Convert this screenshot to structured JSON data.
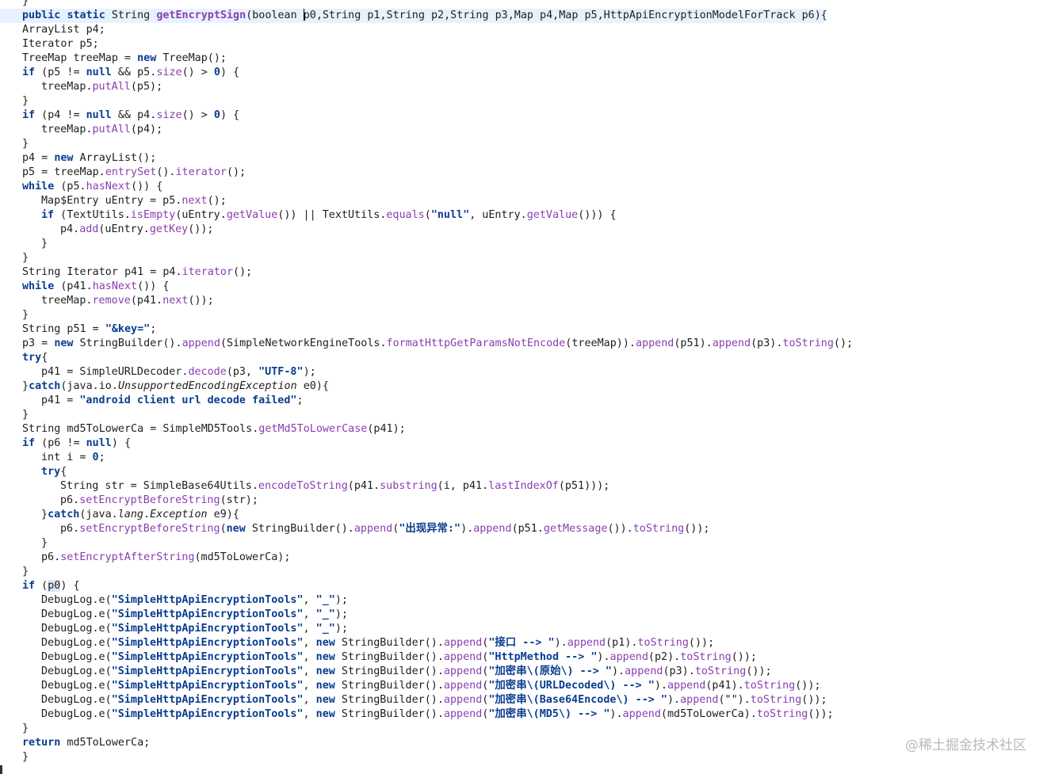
{
  "code_lines": [
    [
      {
        "t": "}"
      }
    ],
    [
      {
        "t": "public",
        "c": "kw"
      },
      {
        "t": " "
      },
      {
        "t": "static",
        "c": "kw"
      },
      {
        "t": " String "
      },
      {
        "t": "getEncryptSign",
        "c": "decl"
      },
      {
        "t": "(boolean "
      },
      {
        "t": "|",
        "c": "caret"
      },
      {
        "t": "p0,String p1,String p2,String p3,Map p4,Map p5,HttpApiEncryptionModelForTrack p6){"
      }
    ],
    [
      {
        "t": "ArrayList p4;"
      }
    ],
    [
      {
        "t": "Iterator p5;"
      }
    ],
    [
      {
        "t": "TreeMap treeMap = "
      },
      {
        "t": "new",
        "c": "kw"
      },
      {
        "t": " TreeMap();"
      }
    ],
    [
      {
        "t": "if",
        "c": "kw"
      },
      {
        "t": " (p5 != "
      },
      {
        "t": "null",
        "c": "kw"
      },
      {
        "t": " && p5."
      },
      {
        "t": "size",
        "c": "mth"
      },
      {
        "t": "() > "
      },
      {
        "t": "0",
        "c": "nm"
      },
      {
        "t": ") {"
      }
    ],
    [
      {
        "t": "treeMap."
      },
      {
        "t": "putAll",
        "c": "mth"
      },
      {
        "t": "(p5);"
      }
    ],
    [
      {
        "t": "}"
      }
    ],
    [
      {
        "t": "if",
        "c": "kw"
      },
      {
        "t": " (p4 != "
      },
      {
        "t": "null",
        "c": "kw"
      },
      {
        "t": " && p4."
      },
      {
        "t": "size",
        "c": "mth"
      },
      {
        "t": "() > "
      },
      {
        "t": "0",
        "c": "nm"
      },
      {
        "t": ") {"
      }
    ],
    [
      {
        "t": "treeMap."
      },
      {
        "t": "putAll",
        "c": "mth"
      },
      {
        "t": "(p4);"
      }
    ],
    [
      {
        "t": "}"
      }
    ],
    [
      {
        "t": "p4 = "
      },
      {
        "t": "new",
        "c": "kw"
      },
      {
        "t": " ArrayList();"
      }
    ],
    [
      {
        "t": "p5 = treeMap."
      },
      {
        "t": "entrySet",
        "c": "mth"
      },
      {
        "t": "()."
      },
      {
        "t": "iterator",
        "c": "mth"
      },
      {
        "t": "();"
      }
    ],
    [
      {
        "t": "while",
        "c": "kw"
      },
      {
        "t": " (p5."
      },
      {
        "t": "hasNext",
        "c": "mth"
      },
      {
        "t": "()) {"
      }
    ],
    [
      {
        "t": "Map$Entry uEntry = p5."
      },
      {
        "t": "next",
        "c": "mth"
      },
      {
        "t": "();"
      }
    ],
    [
      {
        "t": "if",
        "c": "kw"
      },
      {
        "t": " (TextUtils."
      },
      {
        "t": "isEmpty",
        "c": "mth"
      },
      {
        "t": "(uEntry."
      },
      {
        "t": "getValue",
        "c": "mth"
      },
      {
        "t": "()) || TextUtils."
      },
      {
        "t": "equals",
        "c": "mth"
      },
      {
        "t": "("
      },
      {
        "t": "\"null\"",
        "c": "str"
      },
      {
        "t": ", uEntry."
      },
      {
        "t": "getValue",
        "c": "mth"
      },
      {
        "t": "())) {"
      }
    ],
    [
      {
        "t": "p4."
      },
      {
        "t": "add",
        "c": "mth"
      },
      {
        "t": "(uEntry."
      },
      {
        "t": "getKey",
        "c": "mth"
      },
      {
        "t": "());"
      }
    ],
    [
      {
        "t": "}"
      }
    ],
    [
      {
        "t": "}"
      }
    ],
    [
      {
        "t": "String Iterator p41 = p4."
      },
      {
        "t": "iterator",
        "c": "mth"
      },
      {
        "t": "();"
      }
    ],
    [
      {
        "t": "while",
        "c": "kw"
      },
      {
        "t": " (p41."
      },
      {
        "t": "hasNext",
        "c": "mth"
      },
      {
        "t": "()) {"
      }
    ],
    [
      {
        "t": "treeMap."
      },
      {
        "t": "remove",
        "c": "mth"
      },
      {
        "t": "(p41."
      },
      {
        "t": "next",
        "c": "mth"
      },
      {
        "t": "());"
      }
    ],
    [
      {
        "t": "}"
      }
    ],
    [
      {
        "t": "String p51 = "
      },
      {
        "t": "\"&key=\"",
        "c": "str"
      },
      {
        "t": ";"
      }
    ],
    [
      {
        "t": "p3 = "
      },
      {
        "t": "new",
        "c": "kw"
      },
      {
        "t": " StringBuilder()."
      },
      {
        "t": "append",
        "c": "mth"
      },
      {
        "t": "(SimpleNetworkEngineTools."
      },
      {
        "t": "formatHttpGetParamsNotEncode",
        "c": "mth"
      },
      {
        "t": "(treeMap))."
      },
      {
        "t": "append",
        "c": "mth"
      },
      {
        "t": "(p51)."
      },
      {
        "t": "append",
        "c": "mth"
      },
      {
        "t": "(p3)."
      },
      {
        "t": "toString",
        "c": "mth"
      },
      {
        "t": "();"
      }
    ],
    [
      {
        "t": "try",
        "c": "kw"
      },
      {
        "t": "{"
      }
    ],
    [
      {
        "t": "p41 = SimpleURLDecoder."
      },
      {
        "t": "decode",
        "c": "mth"
      },
      {
        "t": "(p3, "
      },
      {
        "t": "\"UTF-8\"",
        "c": "str"
      },
      {
        "t": ");"
      }
    ],
    [
      {
        "t": "}"
      },
      {
        "t": "catch",
        "c": "kw"
      },
      {
        "t": "(java.io."
      },
      {
        "t": "UnsupportedEncodingException",
        "c": "it"
      },
      {
        "t": " e0){"
      }
    ],
    [
      {
        "t": "p41 = "
      },
      {
        "t": "\"android client url decode failed\"",
        "c": "str"
      },
      {
        "t": ";"
      }
    ],
    [
      {
        "t": "}"
      }
    ],
    [
      {
        "t": "String md5ToLowerCa = SimpleMD5Tools."
      },
      {
        "t": "getMd5ToLowerCase",
        "c": "mth"
      },
      {
        "t": "(p41);"
      }
    ],
    [
      {
        "t": "if",
        "c": "kw"
      },
      {
        "t": " (p6 != "
      },
      {
        "t": "null",
        "c": "kw"
      },
      {
        "t": ") {"
      }
    ],
    [
      {
        "t": "int i = "
      },
      {
        "t": "0",
        "c": "nm"
      },
      {
        "t": ";"
      }
    ],
    [
      {
        "t": "try",
        "c": "kw"
      },
      {
        "t": "{"
      }
    ],
    [
      {
        "t": "String str = SimpleBase64Utils."
      },
      {
        "t": "encodeToString",
        "c": "mth"
      },
      {
        "t": "(p41."
      },
      {
        "t": "substring",
        "c": "mth"
      },
      {
        "t": "(i, p41."
      },
      {
        "t": "lastIndexOf",
        "c": "mth"
      },
      {
        "t": "(p51)));"
      }
    ],
    [
      {
        "t": "p6."
      },
      {
        "t": "setEncryptBeforeString",
        "c": "mth"
      },
      {
        "t": "(str);"
      }
    ],
    [
      {
        "t": "}"
      },
      {
        "t": "catch",
        "c": "kw"
      },
      {
        "t": "(java."
      },
      {
        "t": "lang",
        "c": "it"
      },
      {
        "t": "."
      },
      {
        "t": "Exception",
        "c": "it"
      },
      {
        "t": " e9){"
      }
    ],
    [
      {
        "t": "p6."
      },
      {
        "t": "setEncryptBeforeString",
        "c": "mth"
      },
      {
        "t": "("
      },
      {
        "t": "new",
        "c": "kw"
      },
      {
        "t": " StringBuilder()."
      },
      {
        "t": "append",
        "c": "mth"
      },
      {
        "t": "("
      },
      {
        "t": "\"出现异常:\"",
        "c": "str"
      },
      {
        "t": ")."
      },
      {
        "t": "append",
        "c": "mth"
      },
      {
        "t": "(p51."
      },
      {
        "t": "getMessage",
        "c": "mth"
      },
      {
        "t": "())."
      },
      {
        "t": "toString",
        "c": "mth"
      },
      {
        "t": "());"
      }
    ],
    [
      {
        "t": "}"
      }
    ],
    [
      {
        "t": "p6."
      },
      {
        "t": "setEncryptAfterString",
        "c": "mth"
      },
      {
        "t": "(md5ToLowerCa);"
      }
    ],
    [
      {
        "t": "}"
      }
    ],
    [
      {
        "t": "if",
        "c": "kw"
      },
      {
        "t": " ("
      },
      {
        "t": "p0",
        "c": "hl"
      },
      {
        "t": ") {"
      }
    ],
    [
      {
        "t": "DebugLog.e("
      },
      {
        "t": "\"SimpleHttpApiEncryptionTools\"",
        "c": "str"
      },
      {
        "t": ", "
      },
      {
        "t": "\"_\"",
        "c": "str"
      },
      {
        "t": ");"
      }
    ],
    [
      {
        "t": "DebugLog.e("
      },
      {
        "t": "\"SimpleHttpApiEncryptionTools\"",
        "c": "str"
      },
      {
        "t": ", "
      },
      {
        "t": "\"_\"",
        "c": "str"
      },
      {
        "t": ");"
      }
    ],
    [
      {
        "t": "DebugLog.e("
      },
      {
        "t": "\"SimpleHttpApiEncryptionTools\"",
        "c": "str"
      },
      {
        "t": ", "
      },
      {
        "t": "\"_\"",
        "c": "str"
      },
      {
        "t": ");"
      }
    ],
    [
      {
        "t": "DebugLog.e("
      },
      {
        "t": "\"SimpleHttpApiEncryptionTools\"",
        "c": "str"
      },
      {
        "t": ", "
      },
      {
        "t": "new",
        "c": "kw"
      },
      {
        "t": " StringBuilder()."
      },
      {
        "t": "append",
        "c": "mth"
      },
      {
        "t": "("
      },
      {
        "t": "\"接口 --> \"",
        "c": "str"
      },
      {
        "t": ")."
      },
      {
        "t": "append",
        "c": "mth"
      },
      {
        "t": "(p1)."
      },
      {
        "t": "toString",
        "c": "mth"
      },
      {
        "t": "());"
      }
    ],
    [
      {
        "t": "DebugLog.e("
      },
      {
        "t": "\"SimpleHttpApiEncryptionTools\"",
        "c": "str"
      },
      {
        "t": ", "
      },
      {
        "t": "new",
        "c": "kw"
      },
      {
        "t": " StringBuilder()."
      },
      {
        "t": "append",
        "c": "mth"
      },
      {
        "t": "("
      },
      {
        "t": "\"HttpMethod --> \"",
        "c": "str"
      },
      {
        "t": ")."
      },
      {
        "t": "append",
        "c": "mth"
      },
      {
        "t": "(p2)."
      },
      {
        "t": "toString",
        "c": "mth"
      },
      {
        "t": "());"
      }
    ],
    [
      {
        "t": "DebugLog.e("
      },
      {
        "t": "\"SimpleHttpApiEncryptionTools\"",
        "c": "str"
      },
      {
        "t": ", "
      },
      {
        "t": "new",
        "c": "kw"
      },
      {
        "t": " StringBuilder()."
      },
      {
        "t": "append",
        "c": "mth"
      },
      {
        "t": "("
      },
      {
        "t": "\"加密串\\(原始\\) --> \"",
        "c": "str"
      },
      {
        "t": ")."
      },
      {
        "t": "append",
        "c": "mth"
      },
      {
        "t": "(p3)."
      },
      {
        "t": "toString",
        "c": "mth"
      },
      {
        "t": "());"
      }
    ],
    [
      {
        "t": "DebugLog.e("
      },
      {
        "t": "\"SimpleHttpApiEncryptionTools\"",
        "c": "str"
      },
      {
        "t": ", "
      },
      {
        "t": "new",
        "c": "kw"
      },
      {
        "t": " StringBuilder()."
      },
      {
        "t": "append",
        "c": "mth"
      },
      {
        "t": "("
      },
      {
        "t": "\"加密串\\(URLDecoded\\) --> \"",
        "c": "str"
      },
      {
        "t": ")."
      },
      {
        "t": "append",
        "c": "mth"
      },
      {
        "t": "(p41)."
      },
      {
        "t": "toString",
        "c": "mth"
      },
      {
        "t": "());"
      }
    ],
    [
      {
        "t": "DebugLog.e("
      },
      {
        "t": "\"SimpleHttpApiEncryptionTools\"",
        "c": "str"
      },
      {
        "t": ", "
      },
      {
        "t": "new",
        "c": "kw"
      },
      {
        "t": " StringBuilder()."
      },
      {
        "t": "append",
        "c": "mth"
      },
      {
        "t": "("
      },
      {
        "t": "\"加密串\\(Base64Encode\\) --> \"",
        "c": "str"
      },
      {
        "t": ")."
      },
      {
        "t": "append",
        "c": "mth"
      },
      {
        "t": "(\"\")."
      },
      {
        "t": "toString",
        "c": "mth"
      },
      {
        "t": "());"
      }
    ],
    [
      {
        "t": "DebugLog.e("
      },
      {
        "t": "\"SimpleHttpApiEncryptionTools\"",
        "c": "str"
      },
      {
        "t": ", "
      },
      {
        "t": "new",
        "c": "kw"
      },
      {
        "t": " StringBuilder()."
      },
      {
        "t": "append",
        "c": "mth"
      },
      {
        "t": "("
      },
      {
        "t": "\"加密串\\(MD5\\) --> \"",
        "c": "str"
      },
      {
        "t": ")."
      },
      {
        "t": "append",
        "c": "mth"
      },
      {
        "t": "(md5ToLowerCa)."
      },
      {
        "t": "toString",
        "c": "mth"
      },
      {
        "t": "());"
      }
    ],
    [
      {
        "t": "}"
      }
    ],
    [
      {
        "t": "return",
        "c": "kw"
      },
      {
        "t": " md5ToLowerCa;"
      }
    ],
    [
      {
        "t": "}"
      }
    ]
  ],
  "watermark": "@稀土掘金技术社区"
}
